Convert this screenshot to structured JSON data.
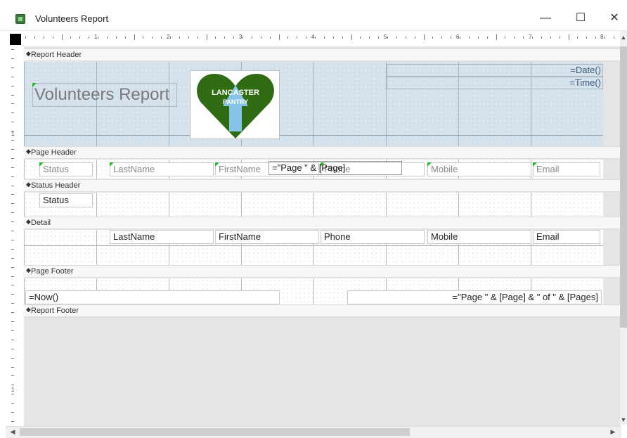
{
  "window": {
    "title": "Volunteers Report",
    "minimize_label": "—",
    "maximize_label": "☐",
    "close_label": "✕"
  },
  "ruler": {
    "h_numbers": [
      "1",
      "2",
      "3",
      "4",
      "5",
      "6",
      "7",
      "8"
    ],
    "v_numbers": [
      "1",
      "1"
    ]
  },
  "sections": {
    "report_header": "Report Header",
    "page_header": "Page Header",
    "status_header": "Status Header",
    "detail": "Detail",
    "page_footer": "Page Footer",
    "report_footer": "Report Footer"
  },
  "report_header": {
    "title": "Volunteers Report",
    "date_expr": "=Date()",
    "time_expr": "=Time()",
    "logo_line1": "LANCASTER",
    "logo_line2": "PANTRY"
  },
  "page_header": {
    "status": "Status",
    "lastname": "LastName",
    "firstname": "FirstName",
    "phone": "Phone",
    "page_expr": "=\"Page \" & [Page]",
    "mobile": "Mobile",
    "email": "Email"
  },
  "status_header": {
    "status": "Status"
  },
  "detail": {
    "lastname": "LastName",
    "firstname": "FirstName",
    "phone": "Phone",
    "mobile": "Mobile",
    "email": "Email"
  },
  "page_footer": {
    "now_expr": "=Now()",
    "pages_expr": "=\"Page \" & [Page] & \" of \" & [Pages]"
  },
  "colors": {
    "header_band": "#d6e3ec",
    "logo_green": "#2f6b12",
    "logo_arrow": "#86c5e8",
    "control_marker": "#22bb22"
  }
}
